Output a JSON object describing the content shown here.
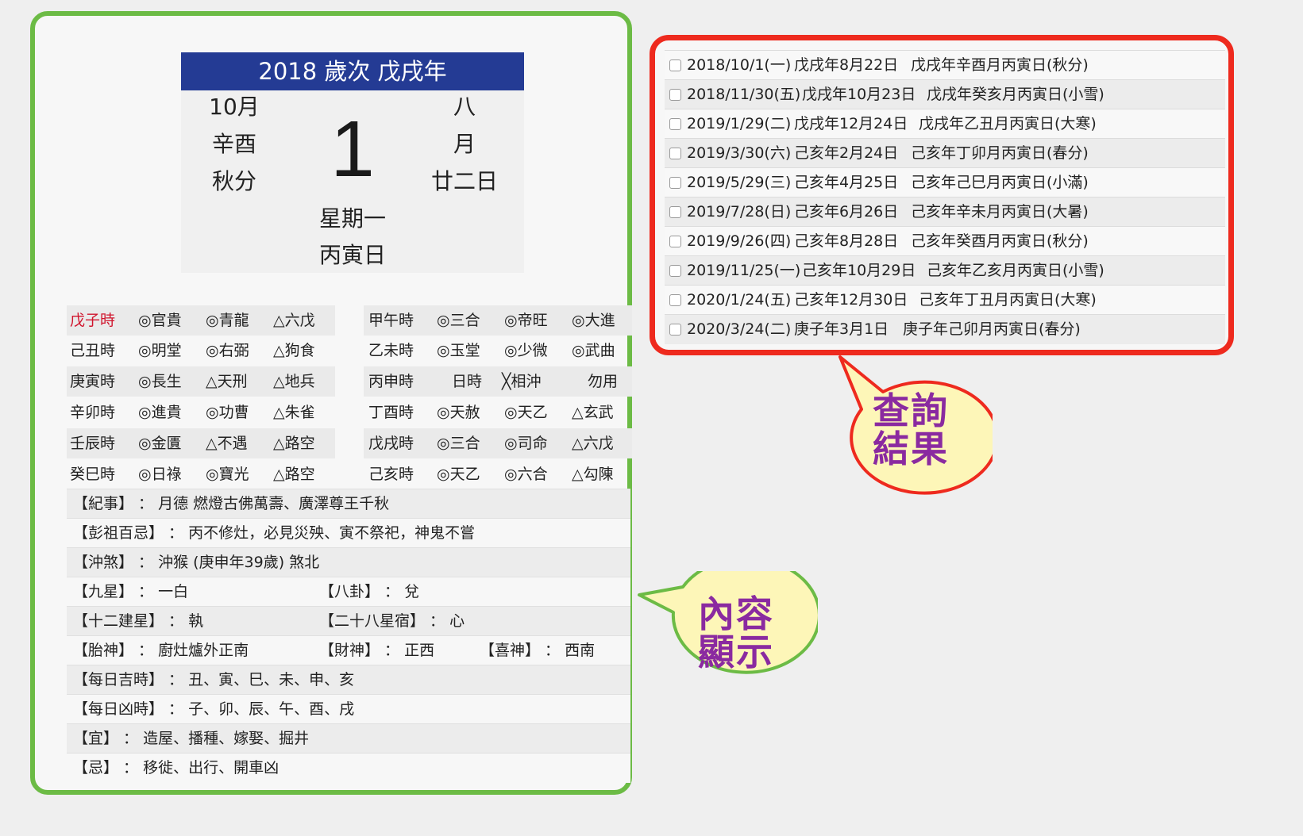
{
  "calendar": {
    "header": "2018 歲次 戊戌年",
    "left": [
      "10月",
      "辛酉",
      "秋分"
    ],
    "day": "1",
    "right": [
      "八",
      "月",
      "廿二日"
    ],
    "weekday": "星期一",
    "day_ganzhi": "丙寅日"
  },
  "hours_left": [
    [
      "戊子時",
      "◎官貴",
      "◎青龍",
      "△六戊"
    ],
    [
      "己丑時",
      "◎明堂",
      "◎右弼",
      "△狗食"
    ],
    [
      "庚寅時",
      "◎長生",
      "△天刑",
      "△地兵"
    ],
    [
      "辛卯時",
      "◎進貴",
      "◎功曹",
      "△朱雀"
    ],
    [
      "壬辰時",
      "◎金匱",
      "△不遇",
      "△路空"
    ],
    [
      "癸巳時",
      "◎日祿",
      "◎寶光",
      "△路空"
    ]
  ],
  "hours_right": [
    [
      "甲午時",
      "◎三合",
      "◎帝旺",
      "◎大進"
    ],
    [
      "乙未時",
      "◎玉堂",
      "◎少微",
      "◎武曲"
    ],
    [
      "丙申時",
      "日時",
      "╳相沖",
      "勿用"
    ],
    [
      "丁酉時",
      "◎天赦",
      "◎天乙",
      "△玄武"
    ],
    [
      "戊戌時",
      "◎三合",
      "◎司命",
      "△六戊"
    ],
    [
      "己亥時",
      "◎天乙",
      "◎六合",
      "△勾陳"
    ]
  ],
  "highlight_color": "#d0142c",
  "info": {
    "jishi": "【紀事】 ： 月德 燃燈古佛萬壽、廣澤尊王千秋",
    "pengzu": "【彭祖百忌】 ： 丙不修灶，必見災殃、寅不祭祀，神鬼不嘗",
    "chongsha": "【沖煞】 ： 沖猴 (庚申年39歲) 煞北",
    "jiuxing": "【九星】 ： 一白",
    "bagua": "【八卦】 ： 兌",
    "jianxing": "【十二建星】 ： 執",
    "xiu": "【二十八星宿】 ： 心",
    "taishen": "【胎神】 ： 廚灶爐外正南",
    "caishen": "【財神】 ： 正西",
    "xishen": "【喜神】 ： 西南",
    "jishi_hours": "【每日吉時】 ： 丑、寅、巳、未、申、亥",
    "xiong_hours": "【每日凶時】 ： 子、卯、辰、午、酉、戌",
    "yi": "【宜】 ： 造屋、播種、嫁娶、掘井",
    "ji": "【忌】 ： 移徙、出行、開車凶"
  },
  "results": [
    {
      "date": "2018/10/1(一)",
      "lunar": "戊戌年8月22日",
      "ganzhi": "戊戌年辛酉月丙寅日(秋分)"
    },
    {
      "date": "2018/11/30(五)",
      "lunar": "戊戌年10月23日",
      "ganzhi": "戊戌年癸亥月丙寅日(小雪)"
    },
    {
      "date": "2019/1/29(二)",
      "lunar": "戊戌年12月24日",
      "ganzhi": "戊戌年乙丑月丙寅日(大寒)"
    },
    {
      "date": "2019/3/30(六)",
      "lunar": "己亥年2月24日",
      "ganzhi": "己亥年丁卯月丙寅日(春分)"
    },
    {
      "date": "2019/5/29(三)",
      "lunar": "己亥年4月25日",
      "ganzhi": "己亥年己巳月丙寅日(小滿)"
    },
    {
      "date": "2019/7/28(日)",
      "lunar": "己亥年6月26日",
      "ganzhi": "己亥年辛未月丙寅日(大暑)"
    },
    {
      "date": "2019/9/26(四)",
      "lunar": "己亥年8月28日",
      "ganzhi": "己亥年癸酉月丙寅日(秋分)"
    },
    {
      "date": "2019/11/25(一)",
      "lunar": "己亥年10月29日",
      "ganzhi": "己亥年乙亥月丙寅日(小雪)"
    },
    {
      "date": "2020/1/24(五)",
      "lunar": "己亥年12月30日",
      "ganzhi": "己亥年丁丑月丙寅日(大寒)"
    },
    {
      "date": "2020/3/24(二)",
      "lunar": "庚子年3月1日",
      "ganzhi": "庚子年己卯月丙寅日(春分)"
    }
  ],
  "callouts": {
    "results_line1": "查詢",
    "results_line2": "結果",
    "content_line1": "內容",
    "content_line2": "顯示"
  },
  "colors": {
    "header_bg": "#243b94",
    "left_border": "#6cbb45",
    "right_border": "#ee2a1e",
    "callout_fill": "#fdf6b8",
    "callout_text": "#8a2aa0"
  }
}
